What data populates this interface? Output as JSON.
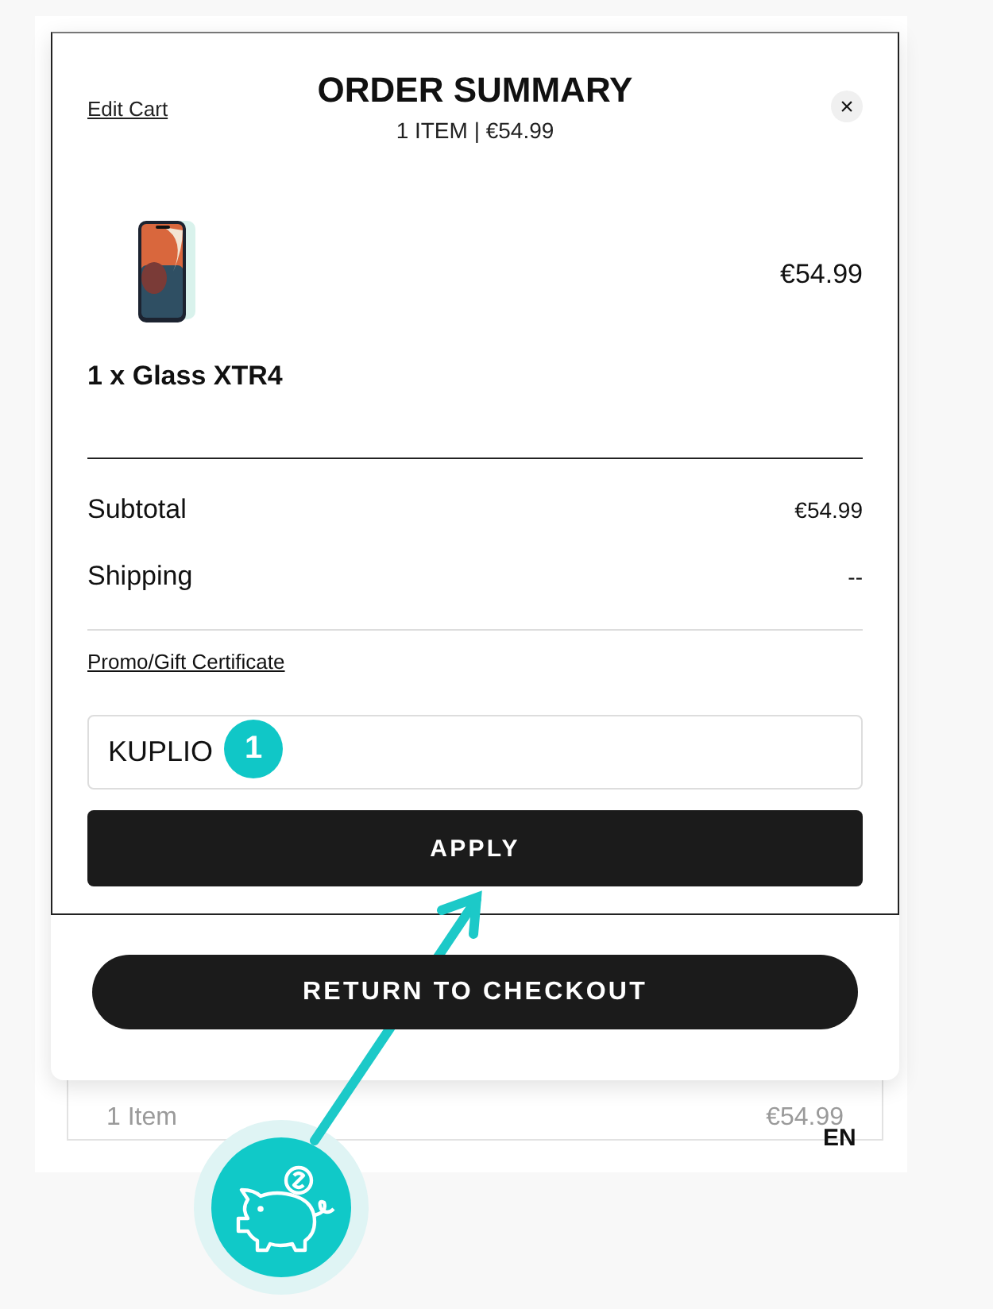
{
  "background_card": {
    "item_count": "1 Item",
    "price": "€54.99"
  },
  "language": "EN",
  "order_summary": {
    "edit_link": "Edit Cart",
    "title": "ORDER SUMMARY",
    "subtitle": "1 ITEM | €54.99",
    "close": "×",
    "items": [
      {
        "name": "1 x Glass XTR4",
        "price": "€54.99",
        "kind": "picture"
      }
    ],
    "totals": [
      {
        "label": "Subtotal",
        "value": "€54.99"
      },
      {
        "label": "Shipping",
        "value": "--"
      }
    ],
    "promo_link": "Promo/Gift Certificate",
    "promo_field": {
      "value": "KUPLIO"
    },
    "apply_button": "APPLY",
    "return_button": "RETURN TO CHECKOUT"
  },
  "annotation": {
    "step_badge": "1"
  }
}
